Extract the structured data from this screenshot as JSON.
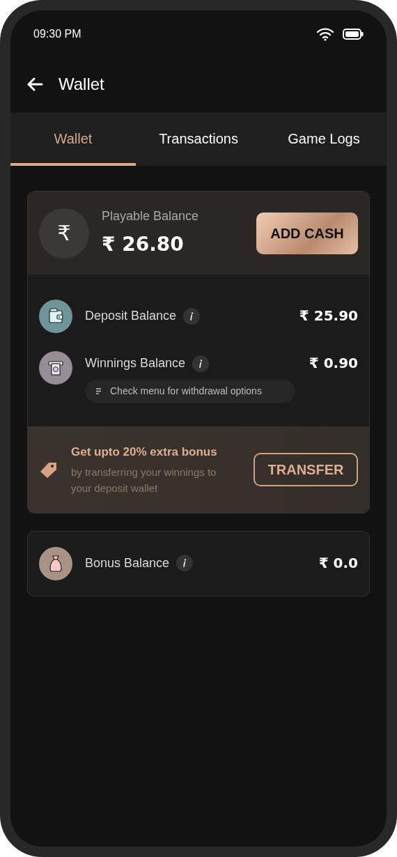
{
  "status_bar": {
    "time": "09:30 PM"
  },
  "header": {
    "title": "Wallet"
  },
  "tabs": [
    {
      "label": "Wallet",
      "selected": true
    },
    {
      "label": "Transactions",
      "selected": false
    },
    {
      "label": "Game Logs",
      "selected": false
    }
  ],
  "playable": {
    "symbol": "₹",
    "label": "Playable Balance",
    "amount": "₹ 26.80",
    "button": "ADD CASH"
  },
  "balances": [
    {
      "kind": "deposit",
      "label": "Deposit Balance",
      "amount": "₹ 25.90"
    },
    {
      "kind": "winnings",
      "label": "Winnings Balance",
      "amount": "₹ 0.90",
      "note": "Check menu for withdrawal options"
    }
  ],
  "promo": {
    "title": "Get upto 20% extra bonus",
    "text": "by transferring your winnings to your deposit wallet",
    "button": "TRANSFER"
  },
  "bonus": [
    {
      "kind": "bonus",
      "label": "Bonus Balance",
      "amount": "₹ 0.0"
    }
  ]
}
